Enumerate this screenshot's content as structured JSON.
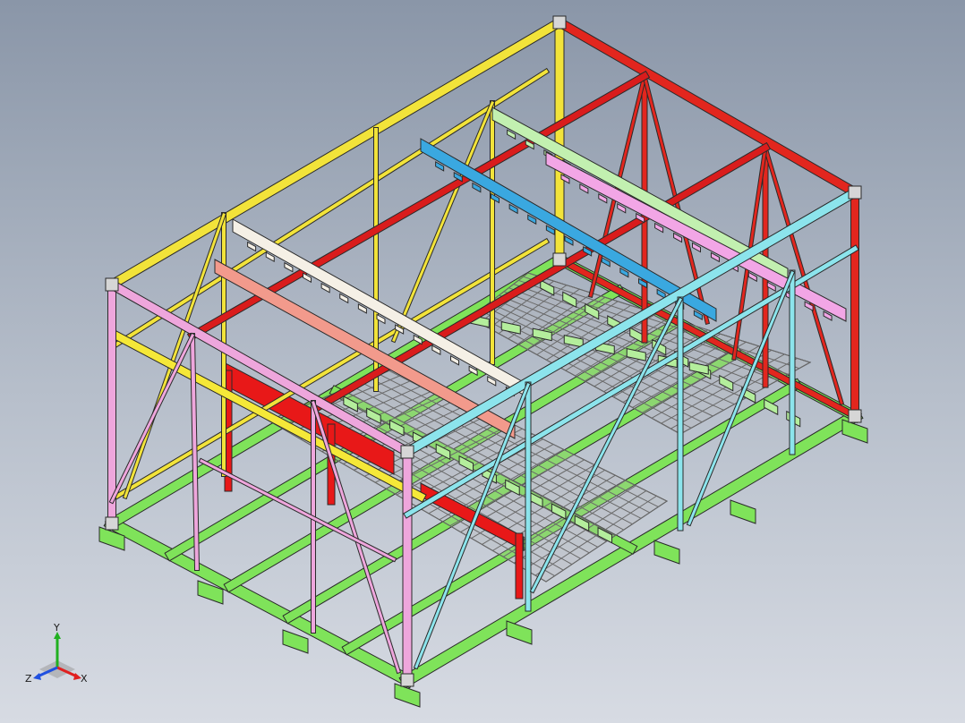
{
  "viewport": {
    "background_top": "#8a96a8",
    "background_bottom": "#d7dbe3"
  },
  "model": {
    "colors": {
      "base_frame": "#7fe35a",
      "mesh": "#6a6a6a",
      "left_long_top": "#f2e33a",
      "back_right_frame": "#e2261e",
      "right_front_top": "#8ce4ec",
      "left_end_top": "#eea6dc",
      "cross_bar_red": "#d91c1c",
      "cross_bar_salmon": "#f29a8c",
      "rack_white": "#f5f0e6",
      "rack_blue": "#3aa8e0",
      "rack_lightgreen": "#c2f0b0",
      "rack_pink": "#f2a6e6",
      "saddle_red": "#e81818",
      "saddle_lightgreen": "#b4ee9c",
      "yellow_beam": "#f5e838",
      "edge": "#2a2a2a"
    }
  },
  "triad": {
    "x_label": "X",
    "y_label": "Y",
    "z_label": "Z",
    "x_color": "#e02020",
    "y_color": "#20b020",
    "z_color": "#2050e0"
  }
}
